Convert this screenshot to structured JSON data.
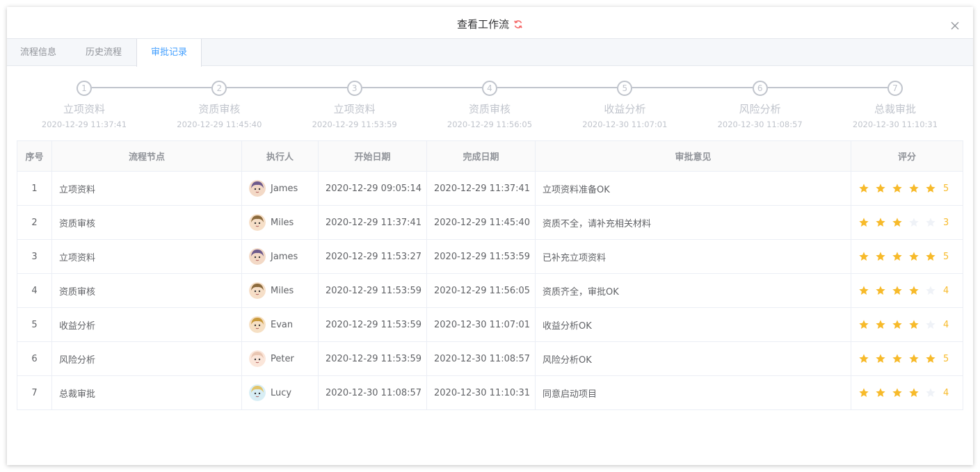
{
  "dialog": {
    "title": "查看工作流"
  },
  "tabs": [
    {
      "label": "流程信息",
      "active": false
    },
    {
      "label": "历史流程",
      "active": false
    },
    {
      "label": "审批记录",
      "active": true
    }
  ],
  "steps": [
    {
      "num": "1",
      "title": "立项资料",
      "time": "2020-12-29 11:37:41"
    },
    {
      "num": "2",
      "title": "资质审核",
      "time": "2020-12-29 11:45:40"
    },
    {
      "num": "3",
      "title": "立项资料",
      "time": "2020-12-29 11:53:59"
    },
    {
      "num": "4",
      "title": "资质审核",
      "time": "2020-12-29 11:56:05"
    },
    {
      "num": "5",
      "title": "收益分析",
      "time": "2020-12-30 11:07:01"
    },
    {
      "num": "6",
      "title": "风险分析",
      "time": "2020-12-30 11:08:57"
    },
    {
      "num": "7",
      "title": "总裁审批",
      "time": "2020-12-30 11:10:31"
    }
  ],
  "table": {
    "headers": [
      "序号",
      "流程节点",
      "执行人",
      "开始日期",
      "完成日期",
      "审批意见",
      "评分"
    ],
    "rows": [
      {
        "index": "1",
        "node": "立项资料",
        "executor": "James",
        "start": "2020-12-29 09:05:14",
        "end": "2020-12-29 11:37:41",
        "comment": "立项资料准备OK",
        "rating": 5,
        "rating_text": "5"
      },
      {
        "index": "2",
        "node": "资质审核",
        "executor": "Miles",
        "start": "2020-12-29 11:37:41",
        "end": "2020-12-29 11:45:40",
        "comment": "资质不全，请补充相关材料",
        "rating": 3,
        "rating_text": "3"
      },
      {
        "index": "3",
        "node": "立项资料",
        "executor": "James",
        "start": "2020-12-29 11:53:27",
        "end": "2020-12-29 11:53:59",
        "comment": "已补充立项资料",
        "rating": 5,
        "rating_text": "5"
      },
      {
        "index": "4",
        "node": "资质审核",
        "executor": "Miles",
        "start": "2020-12-29 11:53:59",
        "end": "2020-12-29 11:56:05",
        "comment": "资质齐全，审批OK",
        "rating": 4,
        "rating_text": "4"
      },
      {
        "index": "5",
        "node": "收益分析",
        "executor": "Evan",
        "start": "2020-12-29 11:53:59",
        "end": "2020-12-30 11:07:01",
        "comment": "收益分析OK",
        "rating": 4,
        "rating_text": "4"
      },
      {
        "index": "6",
        "node": "风险分析",
        "executor": "Peter",
        "start": "2020-12-29 11:53:59",
        "end": "2020-12-30 11:08:57",
        "comment": "风险分析OK",
        "rating": 5,
        "rating_text": "5"
      },
      {
        "index": "7",
        "node": "总裁审批",
        "executor": "Lucy",
        "start": "2020-12-30 11:08:57",
        "end": "2020-12-30 11:10:31",
        "comment": "同意启动项目",
        "rating": 4,
        "rating_text": "4"
      }
    ]
  },
  "colors": {
    "accent": "#409eff",
    "star_on": "#f7ba2a",
    "star_off": "#eff2f7",
    "step_gray": "#c0c4cc",
    "refresh": "#f56c6c"
  },
  "icons": {
    "refresh": "refresh-icon",
    "close": "close-icon",
    "star": "star-icon",
    "avatar": "avatar-icon"
  }
}
